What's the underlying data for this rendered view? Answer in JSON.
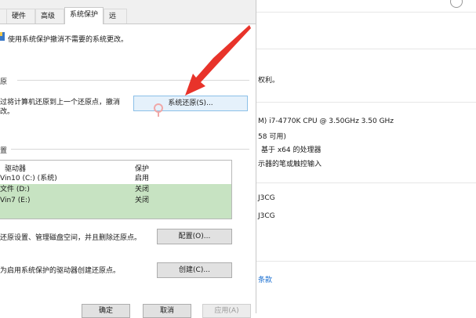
{
  "dialog": {
    "tabs": [
      "硬件",
      "高级",
      "系统保护",
      "远程"
    ],
    "active_tab": "系统保护",
    "intro": "使用系统保护撤消不需要的系统更改。",
    "restore_section": {
      "title": "原",
      "desc_line1": "过将计算机还原到上一个还原点，撤消",
      "desc_line2": "改。",
      "restore_button": "系统还原(S)..."
    },
    "settings_section": {
      "title": "置",
      "columns": [
        "驱动器",
        "保护"
      ],
      "rows": [
        {
          "drive": "Vin10 (C:) (系统)",
          "status": "启用"
        },
        {
          "drive": "文件 (D:)",
          "status": "关闭"
        },
        {
          "drive": "Vin7 (E:)",
          "status": "关闭"
        }
      ],
      "configure_desc": "还原设置、管理磁盘空间，并且删除还原点。",
      "configure_button": "配置(O)...",
      "create_desc": "为启用系统保护的驱动器创建还原点。",
      "create_button": "创建(C)..."
    },
    "footer": {
      "ok": "确定",
      "cancel": "取消",
      "apply": "应用(A)"
    }
  },
  "right_pane": {
    "rights": "权利。",
    "cpu": "M) i7-4770K CPU @ 3.50GHz   3.50 GHz",
    "ram": "58 可用)",
    "system_type": "基于 x64 的处理器",
    "pen": "示器的笔或触控输入",
    "name1": "J3CG",
    "name2": "J3CG",
    "terms": "条款"
  },
  "colors": {
    "selected_row": "#c7e3c2",
    "arrow": "#e8332a",
    "link": "#1a6fd1"
  }
}
